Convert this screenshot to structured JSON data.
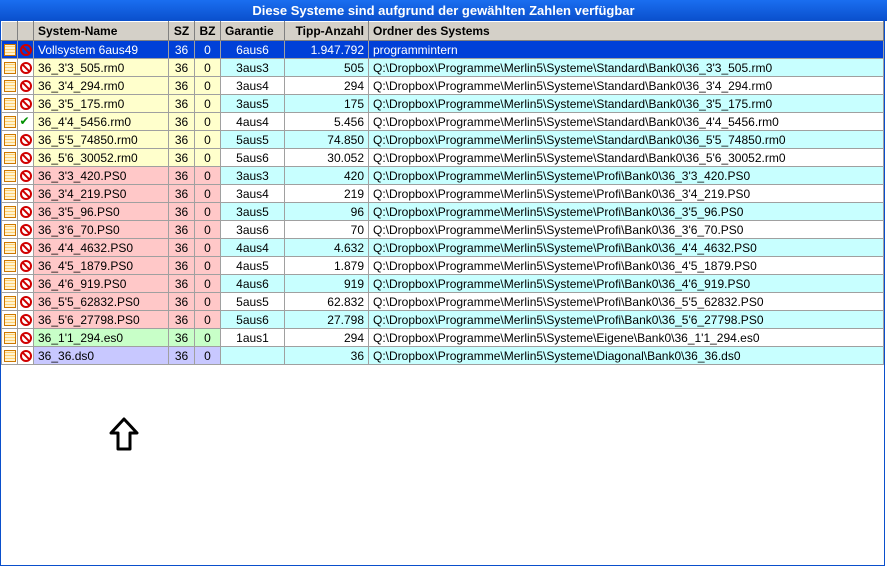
{
  "title": "Diese Systeme sind aufgrund der gewählten Zahlen verfügbar",
  "headers": {
    "name": "System-Name",
    "sz": "SZ",
    "bz": "BZ",
    "gar": "Garantie",
    "tip": "Tipp-Anzahl",
    "ord": "Ordner des Systems"
  },
  "rows": [
    {
      "sel": true,
      "i1": "block",
      "i2": "no",
      "name": "Vollsystem 6aus49",
      "sz": "36",
      "bz": "0",
      "gar": "6aus6",
      "tip": "1.947.792",
      "ord": "programmintern",
      "v": ""
    },
    {
      "i1": "block",
      "i2": "no",
      "name": "36_3'3_505.rm0",
      "sz": "36",
      "bz": "0",
      "gar": "3aus3",
      "tip": "505",
      "ord": "Q:\\Dropbox\\Programme\\Merlin5\\Systeme\\Standard\\Bank0\\36_3'3_505.rm0",
      "v": "yellow",
      "alt": true
    },
    {
      "i1": "block",
      "i2": "no",
      "name": "36_3'4_294.rm0",
      "sz": "36",
      "bz": "0",
      "gar": "3aus4",
      "tip": "294",
      "ord": "Q:\\Dropbox\\Programme\\Merlin5\\Systeme\\Standard\\Bank0\\36_3'4_294.rm0",
      "v": "yellow"
    },
    {
      "i1": "block",
      "i2": "no",
      "name": "36_3'5_175.rm0",
      "sz": "36",
      "bz": "0",
      "gar": "3aus5",
      "tip": "175",
      "ord": "Q:\\Dropbox\\Programme\\Merlin5\\Systeme\\Standard\\Bank0\\36_3'5_175.rm0",
      "v": "yellow",
      "alt": true
    },
    {
      "i1": "block",
      "i2": "ok",
      "name": "36_4'4_5456.rm0",
      "sz": "36",
      "bz": "0",
      "gar": "4aus4",
      "tip": "5.456",
      "ord": "Q:\\Dropbox\\Programme\\Merlin5\\Systeme\\Standard\\Bank0\\36_4'4_5456.rm0",
      "v": "yellow"
    },
    {
      "i1": "block",
      "i2": "no",
      "name": "36_5'5_74850.rm0",
      "sz": "36",
      "bz": "0",
      "gar": "5aus5",
      "tip": "74.850",
      "ord": "Q:\\Dropbox\\Programme\\Merlin5\\Systeme\\Standard\\Bank0\\36_5'5_74850.rm0",
      "v": "yellow",
      "alt": true
    },
    {
      "i1": "block",
      "i2": "no",
      "name": "36_5'6_30052.rm0",
      "sz": "36",
      "bz": "0",
      "gar": "5aus6",
      "tip": "30.052",
      "ord": "Q:\\Dropbox\\Programme\\Merlin5\\Systeme\\Standard\\Bank0\\36_5'6_30052.rm0",
      "v": "yellow"
    },
    {
      "i1": "block",
      "i2": "no",
      "name": "36_3'3_420.PS0",
      "sz": "36",
      "bz": "0",
      "gar": "3aus3",
      "tip": "420",
      "ord": "Q:\\Dropbox\\Programme\\Merlin5\\Systeme\\Profi\\Bank0\\36_3'3_420.PS0",
      "v": "pink",
      "alt": true
    },
    {
      "i1": "block",
      "i2": "no",
      "name": "36_3'4_219.PS0",
      "sz": "36",
      "bz": "0",
      "gar": "3aus4",
      "tip": "219",
      "ord": "Q:\\Dropbox\\Programme\\Merlin5\\Systeme\\Profi\\Bank0\\36_3'4_219.PS0",
      "v": "pink"
    },
    {
      "i1": "block",
      "i2": "no",
      "name": "36_3'5_96.PS0",
      "sz": "36",
      "bz": "0",
      "gar": "3aus5",
      "tip": "96",
      "ord": "Q:\\Dropbox\\Programme\\Merlin5\\Systeme\\Profi\\Bank0\\36_3'5_96.PS0",
      "v": "pink",
      "alt": true
    },
    {
      "i1": "block",
      "i2": "no",
      "name": "36_3'6_70.PS0",
      "sz": "36",
      "bz": "0",
      "gar": "3aus6",
      "tip": "70",
      "ord": "Q:\\Dropbox\\Programme\\Merlin5\\Systeme\\Profi\\Bank0\\36_3'6_70.PS0",
      "v": "pink"
    },
    {
      "i1": "block",
      "i2": "no",
      "name": "36_4'4_4632.PS0",
      "sz": "36",
      "bz": "0",
      "gar": "4aus4",
      "tip": "4.632",
      "ord": "Q:\\Dropbox\\Programme\\Merlin5\\Systeme\\Profi\\Bank0\\36_4'4_4632.PS0",
      "v": "pink",
      "alt": true
    },
    {
      "i1": "block",
      "i2": "no",
      "name": "36_4'5_1879.PS0",
      "sz": "36",
      "bz": "0",
      "gar": "4aus5",
      "tip": "1.879",
      "ord": "Q:\\Dropbox\\Programme\\Merlin5\\Systeme\\Profi\\Bank0\\36_4'5_1879.PS0",
      "v": "pink"
    },
    {
      "i1": "block",
      "i2": "no",
      "name": "36_4'6_919.PS0",
      "sz": "36",
      "bz": "0",
      "gar": "4aus6",
      "tip": "919",
      "ord": "Q:\\Dropbox\\Programme\\Merlin5\\Systeme\\Profi\\Bank0\\36_4'6_919.PS0",
      "v": "pink",
      "alt": true
    },
    {
      "i1": "block",
      "i2": "no",
      "name": "36_5'5_62832.PS0",
      "sz": "36",
      "bz": "0",
      "gar": "5aus5",
      "tip": "62.832",
      "ord": "Q:\\Dropbox\\Programme\\Merlin5\\Systeme\\Profi\\Bank0\\36_5'5_62832.PS0",
      "v": "pink"
    },
    {
      "i1": "block",
      "i2": "no",
      "name": "36_5'6_27798.PS0",
      "sz": "36",
      "bz": "0",
      "gar": "5aus6",
      "tip": "27.798",
      "ord": "Q:\\Dropbox\\Programme\\Merlin5\\Systeme\\Profi\\Bank0\\36_5'6_27798.PS0",
      "v": "pink",
      "alt": true
    },
    {
      "i1": "block",
      "i2": "no",
      "name": "36_1'1_294.es0",
      "sz": "36",
      "bz": "0",
      "gar": "1aus1",
      "tip": "294",
      "ord": "Q:\\Dropbox\\Programme\\Merlin5\\Systeme\\Eigene\\Bank0\\36_1'1_294.es0",
      "v": "green"
    },
    {
      "i1": "block",
      "i2": "no",
      "name": "36_36.ds0",
      "sz": "36",
      "bz": "0",
      "gar": "",
      "tip": "36",
      "ord": "Q:\\Dropbox\\Programme\\Merlin5\\Systeme\\Diagonal\\Bank0\\36_36.ds0",
      "v": "purple",
      "alt": true
    }
  ]
}
